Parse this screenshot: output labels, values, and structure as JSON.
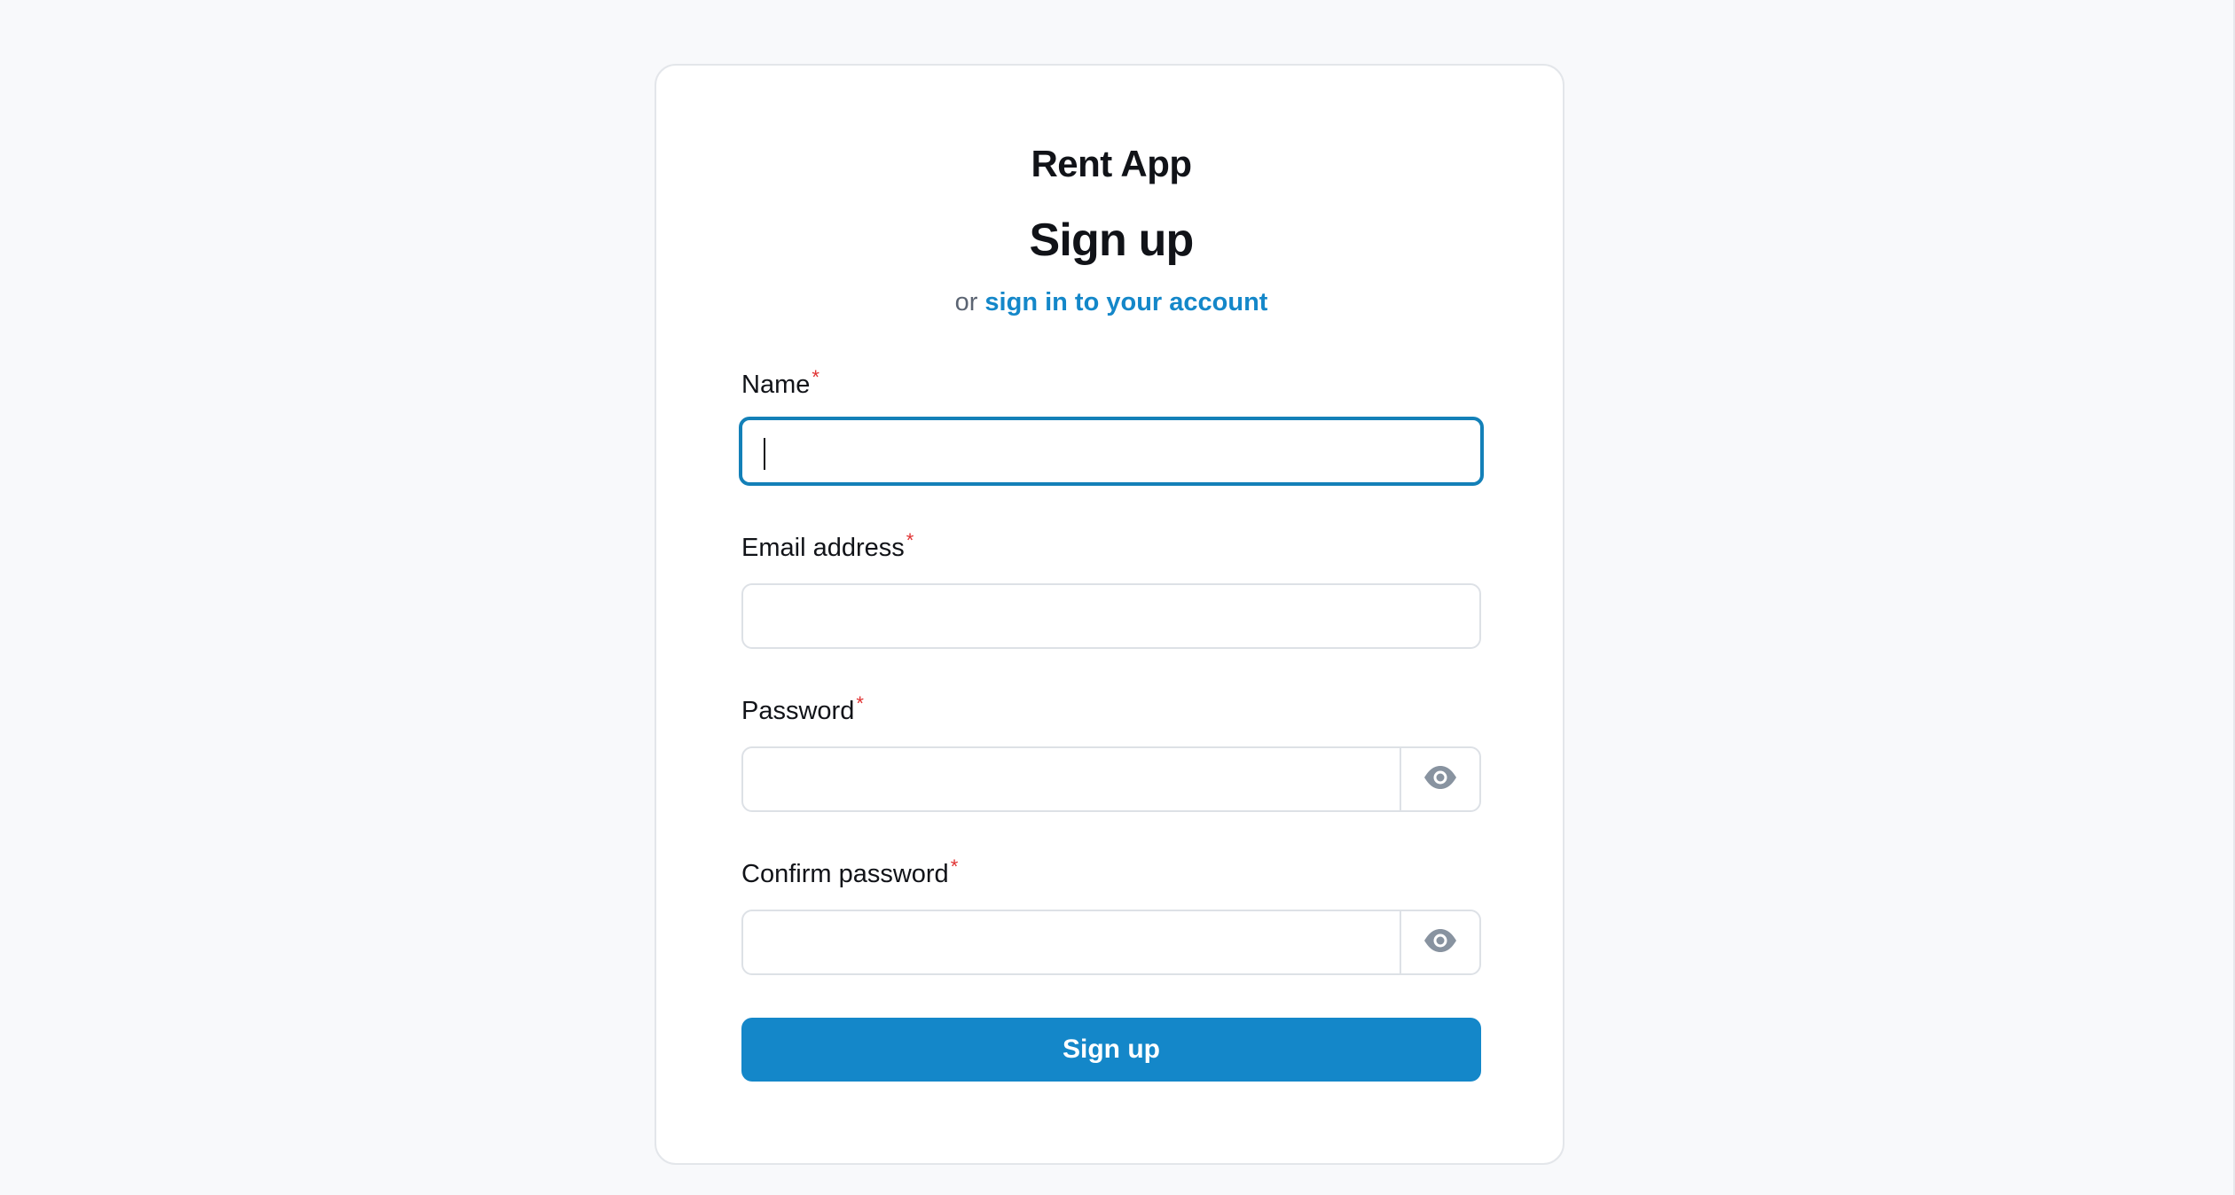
{
  "app": {
    "name": "Rent App"
  },
  "form": {
    "title": "Sign up",
    "alt_prefix": "or",
    "alt_link": "sign in to your account",
    "required_marker": "*",
    "fields": {
      "name": {
        "label": "Name",
        "value": ""
      },
      "email": {
        "label": "Email address",
        "value": ""
      },
      "password": {
        "label": "Password",
        "value": ""
      },
      "confirm_password": {
        "label": "Confirm password",
        "value": ""
      }
    },
    "submit_label": "Sign up"
  },
  "icons": {
    "password_toggle": "eye-icon",
    "confirm_toggle": "eye-icon"
  },
  "colors": {
    "accent": "#1487c9",
    "focus_border": "#1380b8",
    "required": "#e03131",
    "background": "#f8f9fb",
    "icon": "#8893a0"
  }
}
